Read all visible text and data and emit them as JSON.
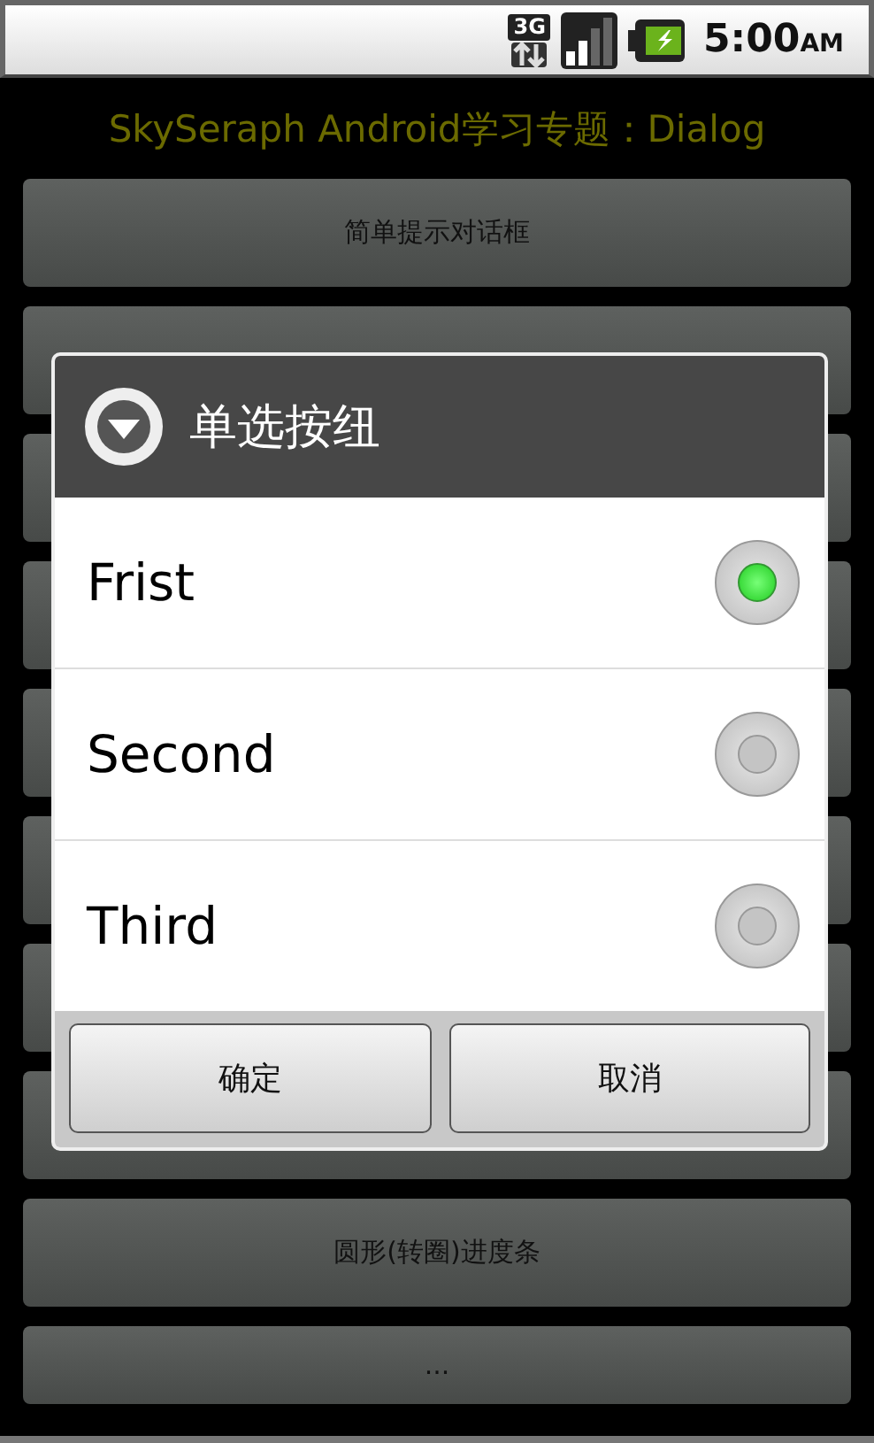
{
  "status_bar": {
    "network": "3G",
    "time": "5:00",
    "ampm": "AM"
  },
  "app_title": "SkySeraph Android学习专题：Dialog",
  "buttons": [
    {
      "kind": "label",
      "label": "简单提示对话框"
    },
    {
      "kind": "covered"
    },
    {
      "kind": "covered"
    },
    {
      "kind": "covered"
    },
    {
      "kind": "covered"
    },
    {
      "kind": "covered"
    },
    {
      "kind": "covered"
    },
    {
      "kind": "covered"
    },
    {
      "kind": "label",
      "label": "圆形(转圈)进度条"
    },
    {
      "kind": "label",
      "label": "..."
    }
  ],
  "dialog": {
    "title": "单选按纽",
    "options": [
      {
        "label": "Frist",
        "selected": true
      },
      {
        "label": "Second",
        "selected": false
      },
      {
        "label": "Third",
        "selected": false
      }
    ],
    "actions": [
      "确定",
      "取消"
    ]
  }
}
